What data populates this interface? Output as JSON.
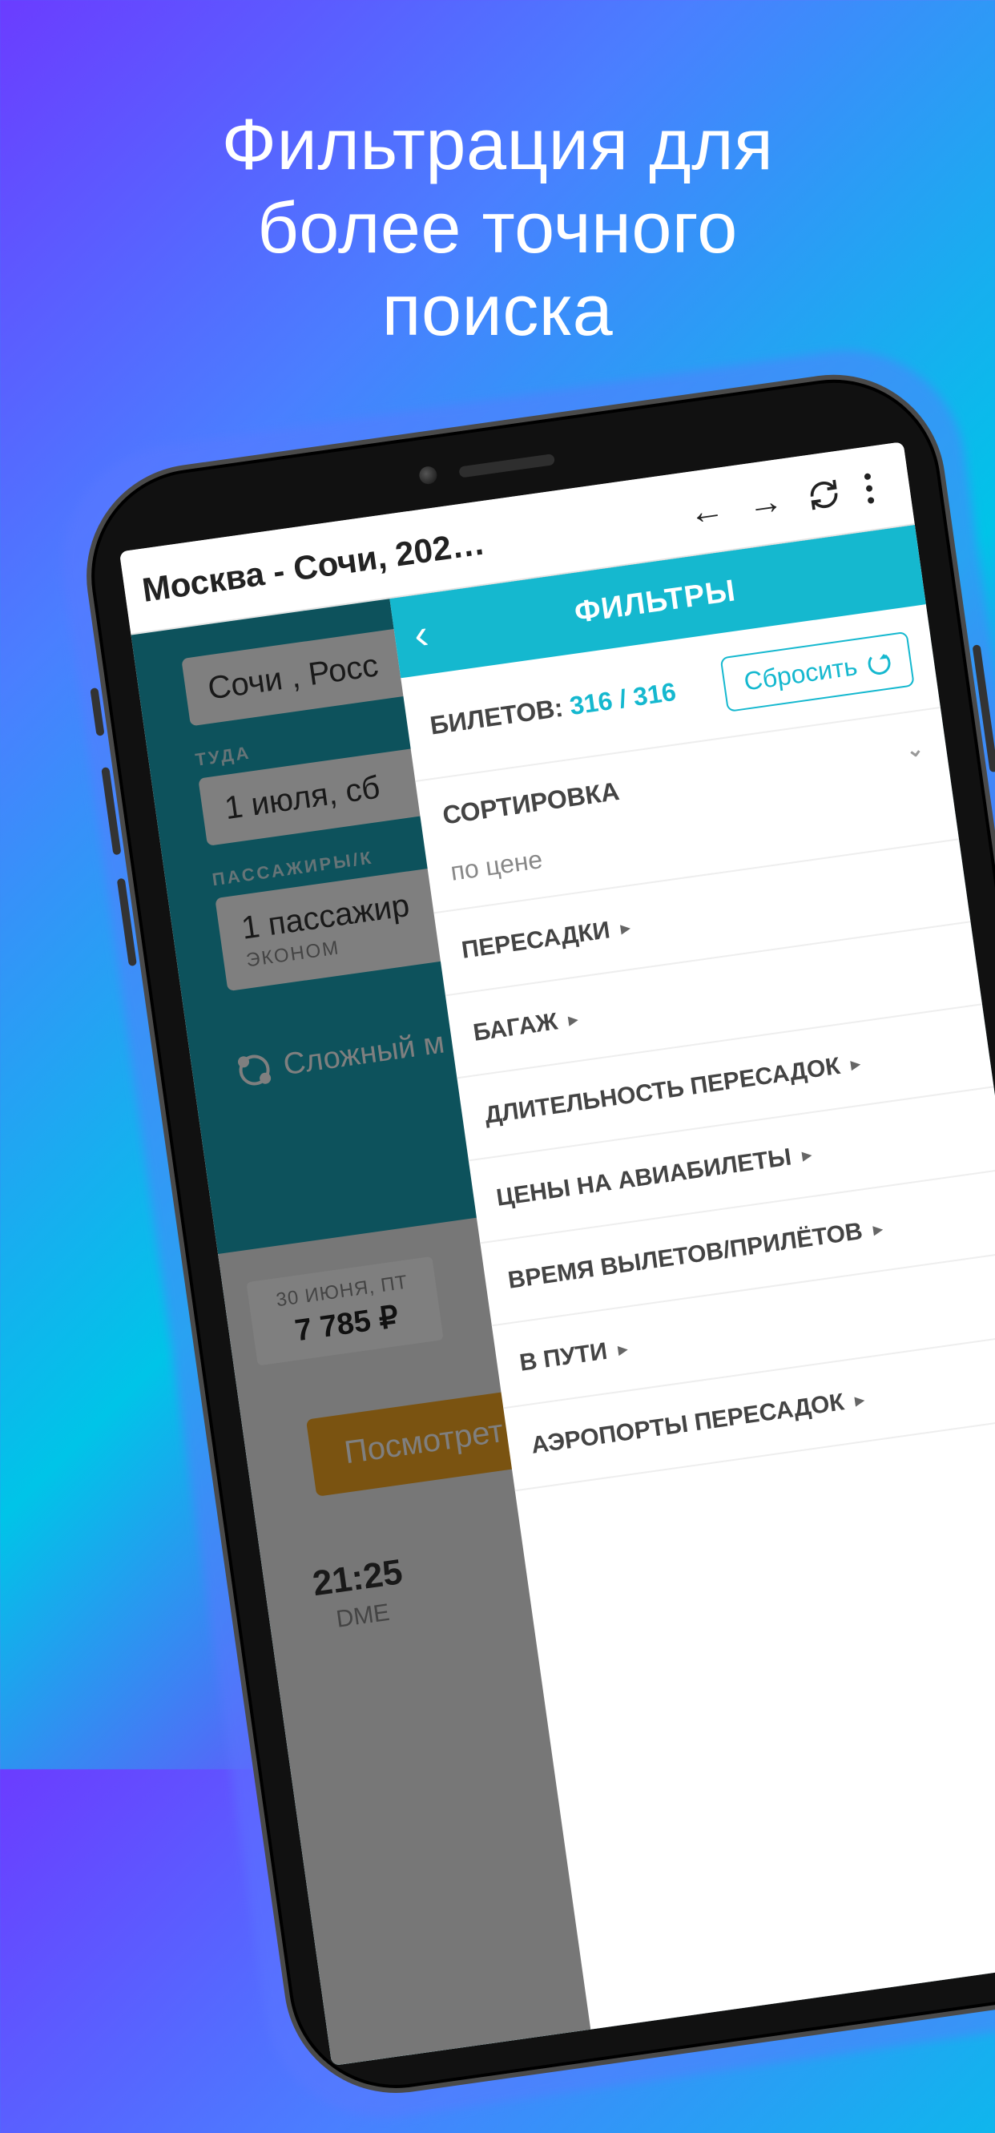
{
  "promo": {
    "title_line1": "Фильтрация для",
    "title_line2": "более точного",
    "title_line3": "поиска"
  },
  "browser": {
    "page_title": "Москва - Сочи, 202…"
  },
  "search": {
    "destination_value": "Сочи , Росс",
    "depart_label": "ТУДА",
    "depart_value": "1 июля, сб",
    "pax_label": "ПАССАЖИРЫ/К",
    "pax_value": "1 пассажир",
    "pax_sub": "ЭКОНОМ",
    "complex_route": "Сложный м",
    "chip_date": "30 ИЮНЯ, ПТ",
    "chip_price": "7 785 ₽",
    "view_button": "Посмотрет",
    "flight_time": "21:25",
    "flight_code": "DME"
  },
  "filters": {
    "header": "ФИЛЬТРЫ",
    "tickets_label": "БИЛЕТОВ:",
    "tickets_count": "316 / 316",
    "reset": "Сбросить",
    "sort_header": "СОРТИРОВКА",
    "sort_value": "по цене",
    "items": [
      "ПЕРЕСАДКИ",
      "БАГАЖ",
      "ДЛИТЕЛЬНОСТЬ ПЕРЕСАДОК",
      "ЦЕНЫ НА АВИАБИЛЕТЫ",
      "ВРЕМЯ ВЫЛЕТОВ/ПРИЛЁТОВ",
      "В ПУТИ",
      "АЭРОПОРТЫ ПЕРЕСАДОК"
    ]
  }
}
